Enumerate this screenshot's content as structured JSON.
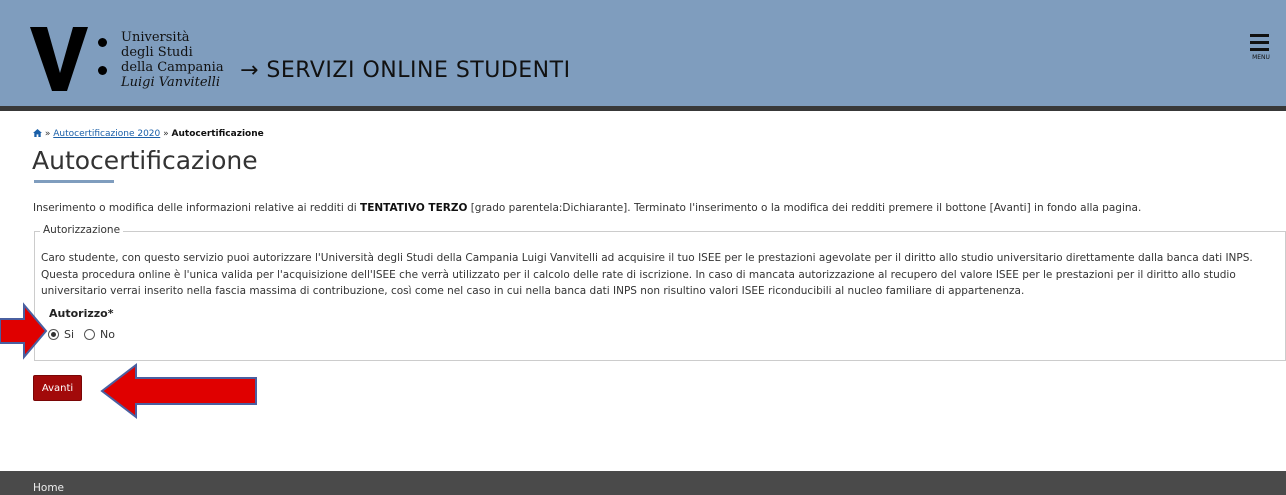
{
  "header": {
    "logo_lines": [
      "Università",
      "degli Studi",
      "della Campania",
      "Luigi Vanvitelli"
    ],
    "title": "→ SERVIZI ONLINE STUDENTI",
    "menu_label": "MENU"
  },
  "breadcrumb": {
    "separator": "»",
    "link": "Autocertificazione 2020",
    "current": "Autocertificazione"
  },
  "page": {
    "title": "Autocertificazione",
    "intro_before": "Inserimento o modifica delle informazioni relative ai redditi di ",
    "intro_name": "TENTATIVO TERZO",
    "intro_after": " [grado parentela:Dichiarante]. Terminato l'inserimento o la modifica dei redditi premere il bottone [Avanti] in fondo alla pagina."
  },
  "autorizzazione": {
    "legend": "Autorizzazione",
    "text_lines": [
      "Caro studente, con questo servizio puoi autorizzare l'Università degli Studi della Campania Luigi Vanvitelli ad acquisire il tuo ISEE per le prestazioni agevolate per il diritto allo studio universitario direttamente dalla banca dati INPS.",
      "Questa procedura online è l'unica valida per l'acquisizione dell'ISEE che verrà utilizzato per il calcolo delle rate di iscrizione. In caso di mancata autorizzazione al recupero del valore ISEE per le prestazioni per il diritto allo studio",
      "universitario verrai inserito nella fascia massima di contribuzione, così come nel caso in cui nella banca dati INPS non risultino valori ISEE riconducibili al nucleo familiare di appartenenza."
    ],
    "field_label": "Autorizzo*",
    "options": [
      {
        "label": "Si",
        "checked": true
      },
      {
        "label": "No",
        "checked": false
      }
    ]
  },
  "buttons": {
    "next": "Avanti"
  },
  "footer": {
    "home": "Home"
  },
  "colors": {
    "header_bg": "#7f9dbe",
    "button_bg": "#a20a0a",
    "annotation_arrow": "#e00000",
    "footer_bg": "#4a4a4a"
  }
}
